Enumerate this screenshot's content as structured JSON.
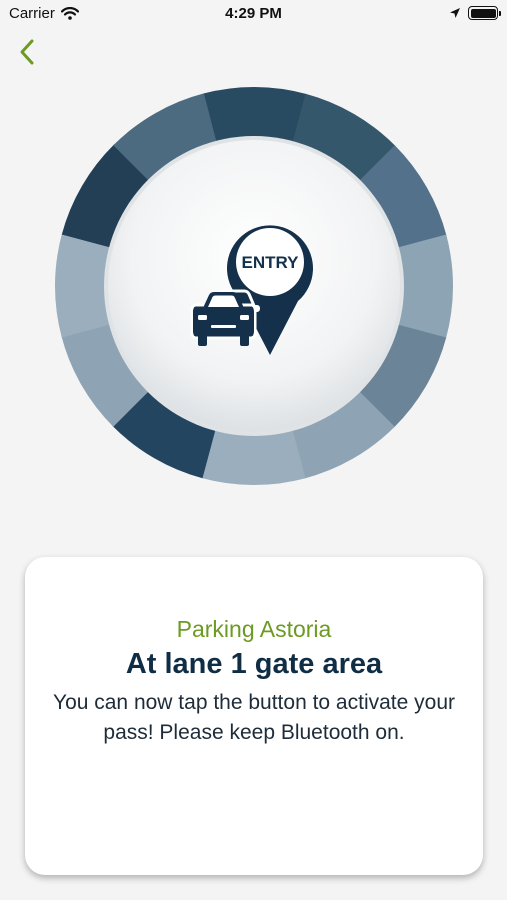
{
  "status_bar": {
    "carrier": "Carrier",
    "time": "4:29 PM",
    "icons": [
      "wifi-icon",
      "location-arrow-icon",
      "battery-icon"
    ]
  },
  "navigation": {
    "back_icon": "chevron-left-icon",
    "accent_color": "#6c9a22"
  },
  "dial": {
    "badge_text": "ENTRY",
    "icons": [
      "map-pin-icon",
      "car-icon"
    ],
    "segment_colors": [
      "#294b61",
      "#34576c",
      "#53718a",
      "#8da4b4",
      "#6b8498",
      "#8ea4b4",
      "#9aaebd",
      "#244560",
      "#8ea4b4",
      "#9aaebd",
      "#223f55",
      "#4d6b80"
    ]
  },
  "card": {
    "location": "Parking Astoria",
    "title": "At lane 1 gate area",
    "message": "You can now tap the button to activate your pass! Please keep Bluetooth on."
  }
}
